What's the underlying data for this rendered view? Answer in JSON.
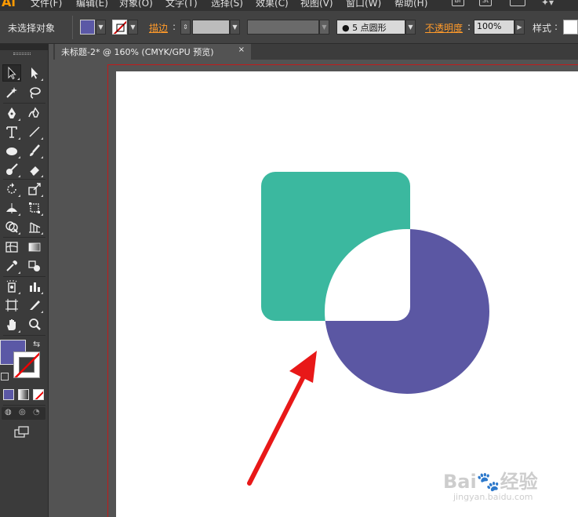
{
  "app": {
    "logo": "Ai"
  },
  "menubar": {
    "items": [
      "文件(F)",
      "编辑(E)",
      "对象(O)",
      "文字(T)",
      "选择(S)",
      "效果(C)",
      "视图(V)",
      "窗口(W)",
      "帮助(H)"
    ],
    "bridge_label": "Br",
    "stock_label": "St"
  },
  "controlbar": {
    "selection_status": "未选择对象",
    "fill_color": "#5b58a6",
    "stroke_label": "描边",
    "stroke_weight_value": "",
    "brush_label": "5 点圆形",
    "opacity_label": "不透明度",
    "opacity_value": "100%",
    "style_label": "样式"
  },
  "document": {
    "tab_title": "未标题-2* @ 160% (CMYK/GPU 预览)",
    "close_glyph": "×"
  },
  "tools": {
    "fill_color": "#5b58a6",
    "stroke_color": "none"
  },
  "artwork": {
    "square_color": "#3bb89f",
    "circle_color": "#5b57a3",
    "arrow_color": "#e81818"
  },
  "watermark": {
    "brand": "Bai",
    "brand2": "经验",
    "url": "jingyan.baidu.com"
  }
}
